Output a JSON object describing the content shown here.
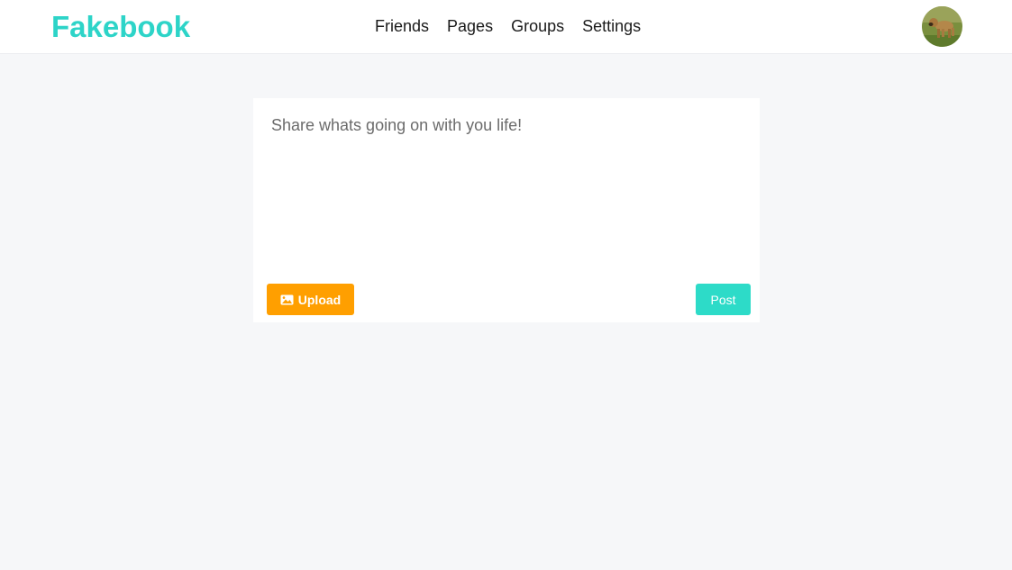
{
  "header": {
    "logo": "Fakebook",
    "nav": [
      {
        "label": "Friends"
      },
      {
        "label": "Pages"
      },
      {
        "label": "Groups"
      },
      {
        "label": "Settings"
      }
    ],
    "avatar_icon": "dog-avatar"
  },
  "composer": {
    "placeholder": "Share whats going on with you life!",
    "value": "",
    "upload_label": "Upload",
    "upload_icon": "image-icon",
    "post_label": "Post"
  },
  "colors": {
    "brand": "#2dd4c8",
    "upload": "#ff9f00",
    "post": "#2ddbc8",
    "background": "#f6f7f9"
  }
}
